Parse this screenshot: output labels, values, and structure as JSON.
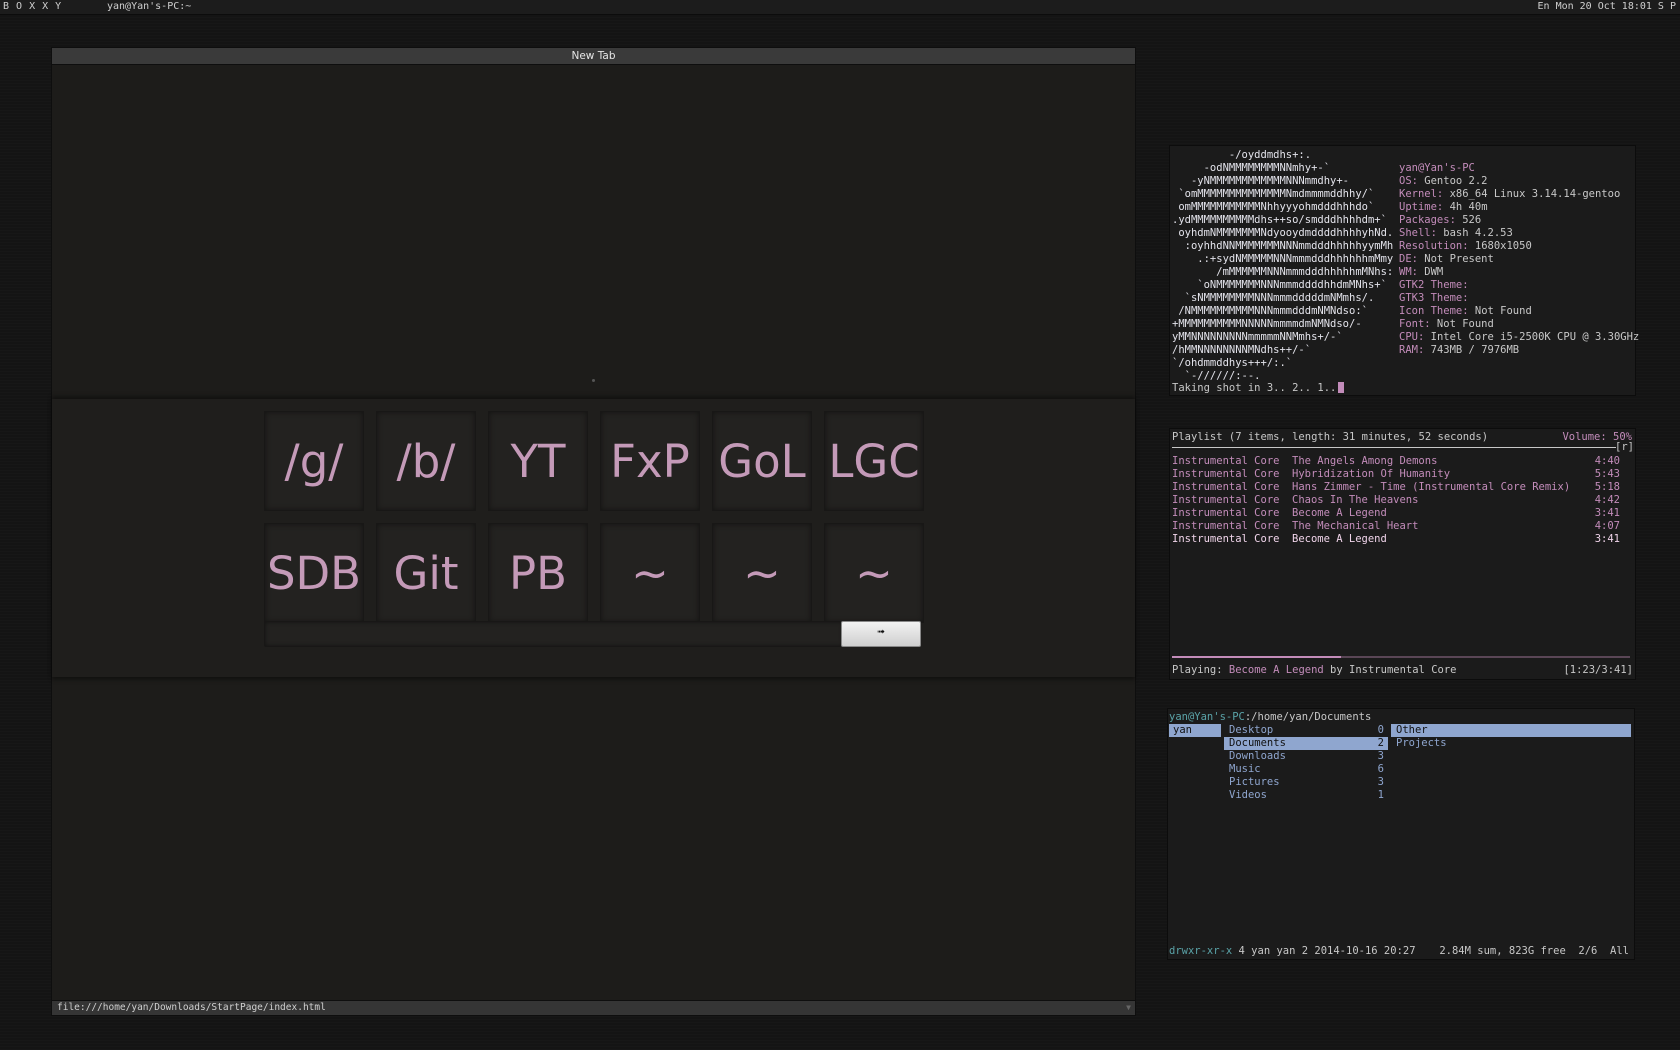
{
  "topbar": {
    "tags": [
      "B",
      "O",
      "X",
      "X",
      "Y"
    ],
    "window_title": "yan@Yan's-PC:~",
    "status": "En Mon 20 Oct 18:01 S P"
  },
  "browser": {
    "tab_title": "New Tab",
    "tiles_row1": [
      "/g/",
      "/b/",
      "YT",
      "FxP",
      "GoL",
      "LGC"
    ],
    "tiles_row2": [
      "SDB",
      "Git",
      "PB",
      "~",
      "~",
      "~"
    ],
    "search_value": "",
    "go_label": "➟",
    "status_url": "file:///home/yan/Downloads/StartPage/index.html"
  },
  "neofetch": {
    "logo": [
      "         -/oyddmdhs+:.",
      "     -odNMMMMMMMMNNmhy+-`",
      "   -yNMMMMMMMMMMMMNNNmmdhy+-",
      " `omMMMMMMMMMMMMMMNmdmmmmddhhy/`",
      " omMMMMMMMMMMMNhhyyyohmdddhhhdo`",
      ".ydMMMMMMMMMMdhs++so/smdddhhhhdm+`",
      " oyhdmNMMMMMMMNdyooydmddddhhhhyhNd.",
      "  :oyhhdNNMMMMMMMNNNmmdddhhhhhyymMh",
      "    .:+sydNMMMMMNNNmmmdddhhhhhhmMmy",
      "       /mMMMMMMNNNmmmdddhhhhhmMNhs:",
      "    `oNMMMMMMMNNNmmmddddhhdmMNhs+`",
      "  `sNMMMMMMMMNNNmmmdddddmNMmhs/.",
      " /NMMMMMMMMMMNNNmmmdddmNMNdso:`",
      "+MMMMMMMMMMNNNNNmmmmdmNMNdso/-",
      "yMMNNNNNNNNNmmmmmNNMmhs+/-`",
      "/hMMNNNNNNNNMNdhs++/-`",
      "`/ohdmmddhys+++/:.`",
      "  `-//////:--."
    ],
    "info": [
      {
        "key": "",
        "val": "yan@Yan's-PC"
      },
      {
        "key": "OS:",
        "val": " Gentoo 2.2"
      },
      {
        "key": "Kernel:",
        "val": " x86_64 Linux 3.14.14-gentoo"
      },
      {
        "key": "Uptime:",
        "val": " 4h 40m"
      },
      {
        "key": "Packages:",
        "val": " 526"
      },
      {
        "key": "Shell:",
        "val": " bash 4.2.53"
      },
      {
        "key": "Resolution:",
        "val": " 1680x1050"
      },
      {
        "key": "DE:",
        "val": " Not Present"
      },
      {
        "key": "WM:",
        "val": " DWM"
      },
      {
        "key": "GTK2 Theme:",
        "val": ""
      },
      {
        "key": "GTK3 Theme:",
        "val": ""
      },
      {
        "key": "Icon Theme:",
        "val": " Not Found"
      },
      {
        "key": "Font:",
        "val": " Not Found"
      },
      {
        "key": "CPU:",
        "val": " Intel Core i5-2500K CPU @ 3.30GHz"
      },
      {
        "key": "RAM:",
        "val": " 743MB / 7976MB"
      }
    ],
    "prompt": "Taking shot in 3.. 2.. 1.."
  },
  "player": {
    "header": "Playlist (7 items, length: 31 minutes, 52 seconds)",
    "volume": "Volume: 50%",
    "flags": "[r]",
    "tracks": [
      {
        "artist": "Instrumental Core",
        "title": "The Angels Among Demons",
        "duration": "4:40"
      },
      {
        "artist": "Instrumental Core",
        "title": "Hybridization Of Humanity",
        "duration": "5:43"
      },
      {
        "artist": "Instrumental Core",
        "title": "Hans Zimmer - Time (Instrumental Core Remix)",
        "duration": "5:18"
      },
      {
        "artist": "Instrumental Core",
        "title": "Chaos In The Heavens",
        "duration": "4:42"
      },
      {
        "artist": "Instrumental Core",
        "title": "Become A Legend",
        "duration": "3:41"
      },
      {
        "artist": "Instrumental Core",
        "title": "The Mechanical Heart",
        "duration": "4:07"
      },
      {
        "artist": "Instrumental Core",
        "title": "Become A Legend",
        "duration": "3:41"
      }
    ],
    "current_index": 6,
    "progress_fraction": 0.37,
    "now_label": "Playing: ",
    "now_title": "Become A Legend",
    "now_by": " by Instrumental Core",
    "elapsed": "[1:23/3:41]"
  },
  "files": {
    "path_user": "yan@Yan's-PC",
    "path_dir": ":/home/yan/Documents",
    "parent": "yan",
    "entries": [
      {
        "name": "Desktop",
        "count": "0"
      },
      {
        "name": "Documents",
        "count": "2"
      },
      {
        "name": "Downloads",
        "count": "3"
      },
      {
        "name": "Music",
        "count": "6"
      },
      {
        "name": "Pictures",
        "count": "3"
      },
      {
        "name": "Videos",
        "count": "1"
      }
    ],
    "selected_entry": 1,
    "preview": [
      "Other",
      "Projects"
    ],
    "footer_perm": "drwxr-xr-x",
    "footer_info": " 4 yan yan 2 2014-10-16 20:27",
    "footer_right": "2.84M sum, 823G free  2/6  All"
  }
}
